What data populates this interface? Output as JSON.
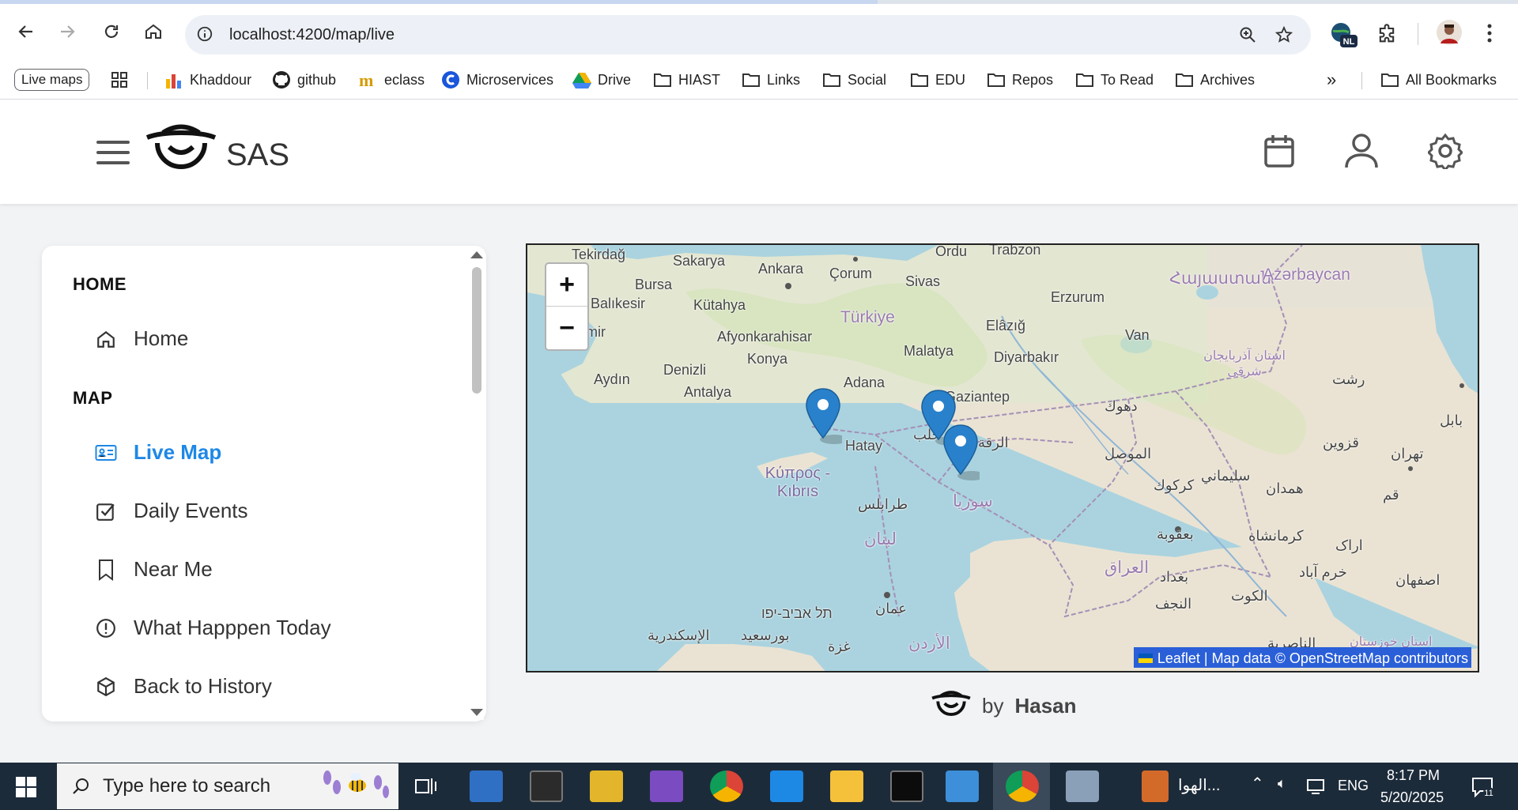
{
  "browser": {
    "url": "localhost:4200/map/live",
    "extension_badge": "NL",
    "bookmarks": [
      {
        "label": "Live maps",
        "icon": "pill"
      },
      {
        "label": "Khaddour",
        "icon": "chart-bars-icon"
      },
      {
        "label": "github",
        "icon": "github-icon"
      },
      {
        "label": "eclass",
        "icon": "eclass-icon"
      },
      {
        "label": "Microservices",
        "icon": "c-logo-icon"
      },
      {
        "label": "Drive",
        "icon": "drive-icon"
      },
      {
        "label": "HIAST",
        "icon": "folder-icon"
      },
      {
        "label": "Links",
        "icon": "folder-icon"
      },
      {
        "label": "Social",
        "icon": "folder-icon"
      },
      {
        "label": "EDU",
        "icon": "folder-icon"
      },
      {
        "label": "Repos",
        "icon": "folder-icon"
      },
      {
        "label": "To Read",
        "icon": "folder-icon"
      },
      {
        "label": "Archives",
        "icon": "folder-icon"
      }
    ],
    "more_bookmarks": "»",
    "all_bookmarks": "All Bookmarks"
  },
  "app": {
    "brand": "SAS"
  },
  "sidebar": {
    "sections": [
      {
        "title": "HOME",
        "items": [
          {
            "label": "Home",
            "icon": "home-icon"
          }
        ]
      },
      {
        "title": "MAP",
        "items": [
          {
            "label": "Live Map",
            "icon": "id-card-icon",
            "active": true
          },
          {
            "label": "Daily Events",
            "icon": "checkbox-icon"
          },
          {
            "label": "Near Me",
            "icon": "bookmark-icon"
          },
          {
            "label": "What Happpen Today",
            "icon": "alert-circle-icon"
          },
          {
            "label": "Back to History",
            "icon": "cube-icon"
          }
        ]
      }
    ]
  },
  "map": {
    "zoom_in": "+",
    "zoom_out": "−",
    "attribution": "Leaflet | Map data © OpenStreetMap contributors",
    "labels": {
      "tekirdag": "Tekirdağ",
      "sakarya": "Sakarya",
      "ankara": "Ankara",
      "corum": "Çorum",
      "ordu": "Ordu",
      "trabzon": "Trabzon",
      "sivas": "Sivas",
      "bursa": "Bursa",
      "balikesir": "Balıkesir",
      "kutahya": "Kütahya",
      "turkiye": "Türkiye",
      "elazig": "Elâzığ",
      "erzurum": "Erzurum",
      "armenia": "Հայաստան",
      "azerbaijan": "Azərbaycan",
      "izmir": "İzmir",
      "afyon": "Afyonkarahisar",
      "malatya": "Malatya",
      "van": "Van",
      "diyarbakir": "Diyarbakır",
      "denizli": "Denizli",
      "konya": "Konya",
      "aydin": "Aydın",
      "antalya": "Antalya",
      "adana": "Adana",
      "gaziantep": "Gaziantep",
      "azerbaijan_east": "استان آذربایجان شرقی",
      "rasht": "رشت",
      "babil": "بابل",
      "dohuk": "دهوك",
      "aleppo": "حلب",
      "hatay": "Hatay",
      "raqqa": "الرقة",
      "mosul": "الموصل",
      "qazvin": "قزوين",
      "tehran": "تهران",
      "sulaymaniyah": "سليماني",
      "kirkuk": "كركوك",
      "cyprus": "Κύπρος - Kıbrıs",
      "tripoli": "طرابلس",
      "syria": "سوريا",
      "hamadan": "همدان",
      "qom": "قم",
      "lebanon": "لبنان",
      "baqubah": "بعقوبة",
      "kermanshah": "كرمانشاه",
      "arak": "اراک",
      "iraq": "العراق",
      "baghdad": "بغداد",
      "khorramabad": "خرم آباد",
      "isfahan": "اصفهان",
      "najaf": "النجف",
      "kut": "الكوت",
      "telaviv": "תל אביב-יפו",
      "amman": "عمان",
      "alexandria": "الإسكندرية",
      "portsaid": "بورسعيد",
      "gaza": "غزة",
      "jordan": "الأردن",
      "nasiriyah": "الناصرية",
      "khuzestan": "استان خوزستان"
    },
    "markers": [
      {
        "name": "marker-hatay"
      },
      {
        "name": "marker-raqqa-east"
      },
      {
        "name": "marker-deir-ez-zor"
      }
    ]
  },
  "footer": {
    "by": "by",
    "author": "Hasan"
  },
  "taskbar": {
    "search_placeholder": "Type here to search",
    "arabic_app": "الهوا...",
    "lang": "ENG",
    "time": "8:17 PM",
    "date": "5/20/2025",
    "notifications": "11"
  }
}
